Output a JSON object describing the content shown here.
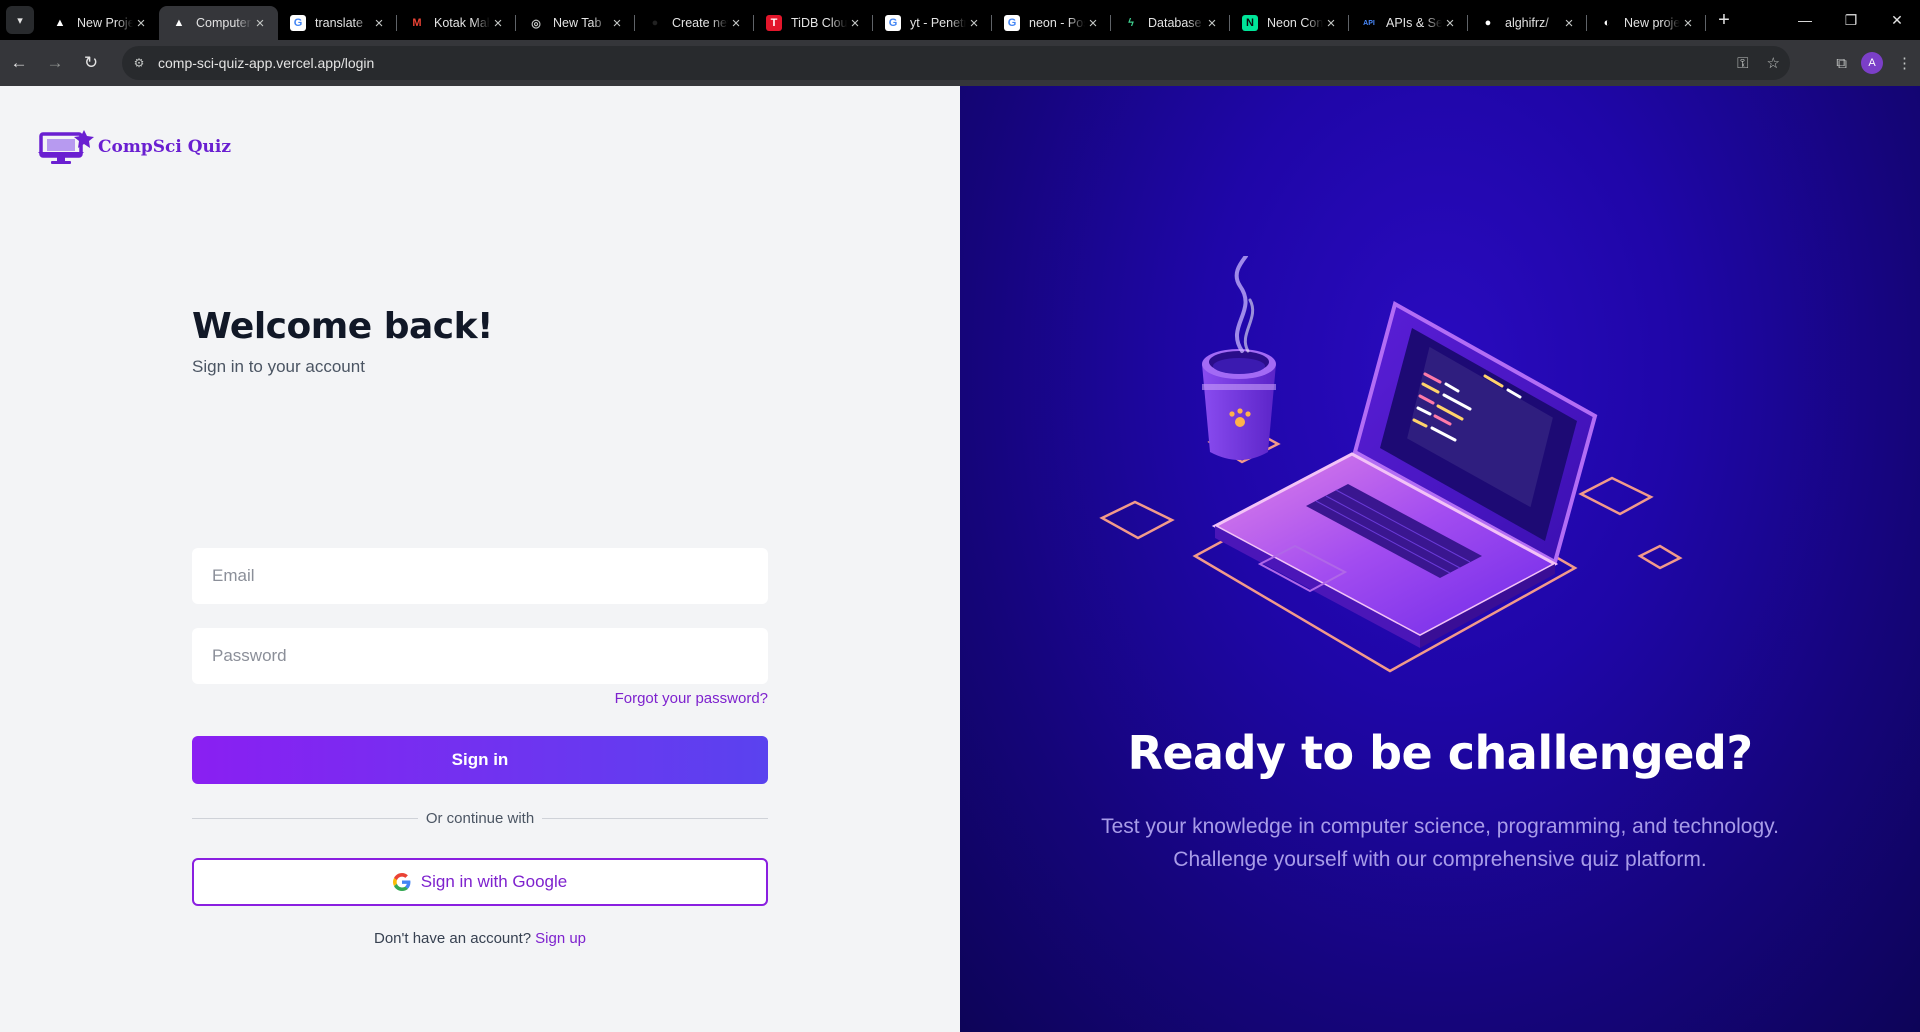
{
  "browser": {
    "tabs": [
      {
        "title": "New Project",
        "icon": "vercel-icon",
        "active": false
      },
      {
        "title": "Computer Science Quiz",
        "icon": "vercel-icon",
        "active": true
      },
      {
        "title": "translate",
        "icon": "google-icon",
        "active": false
      },
      {
        "title": "Kotak Mahindra",
        "icon": "gmail-icon",
        "active": false
      },
      {
        "title": "New Tab",
        "icon": "chrome-icon",
        "active": false
      },
      {
        "title": "Create new",
        "icon": "dark-icon",
        "active": false
      },
      {
        "title": "TiDB Cloud",
        "icon": "tidb-icon",
        "active": false
      },
      {
        "title": "yt - Penetration",
        "icon": "google-icon",
        "active": false
      },
      {
        "title": "neon - Postgres",
        "icon": "google-icon",
        "active": false
      },
      {
        "title": "Database",
        "icon": "supabase-icon",
        "active": false
      },
      {
        "title": "Neon Console",
        "icon": "neon-icon",
        "active": false
      },
      {
        "title": "APIs & Services",
        "icon": "api-icon",
        "active": false
      },
      {
        "title": "alghifrz/",
        "icon": "github-icon",
        "active": false
      },
      {
        "title": "New project",
        "icon": "generic-icon",
        "active": false
      }
    ],
    "url": "comp-sci-quiz-app.vercel.app/login",
    "avatar_letter": "A"
  },
  "logo": {
    "text": "CompSci Quiz"
  },
  "login": {
    "title": "Welcome back!",
    "subtitle": "Sign in to your account",
    "email_placeholder": "Email",
    "password_placeholder": "Password",
    "forgot_label": "Forgot your password?",
    "signin_label": "Sign in",
    "divider_label": "Or continue with",
    "google_label": "Sign in with Google",
    "signup_prompt": "Don't have an account?",
    "signup_label": "Sign up"
  },
  "hero": {
    "title": "Ready to be challenged?",
    "line1": "Test your knowledge in computer science, programming, and technology.",
    "line2": "Challenge yourself with our comprehensive quiz platform."
  },
  "colors": {
    "accent": "#7e22ce",
    "hero_bg": "#1f06a8",
    "page_bg": "#f3f4f6"
  }
}
